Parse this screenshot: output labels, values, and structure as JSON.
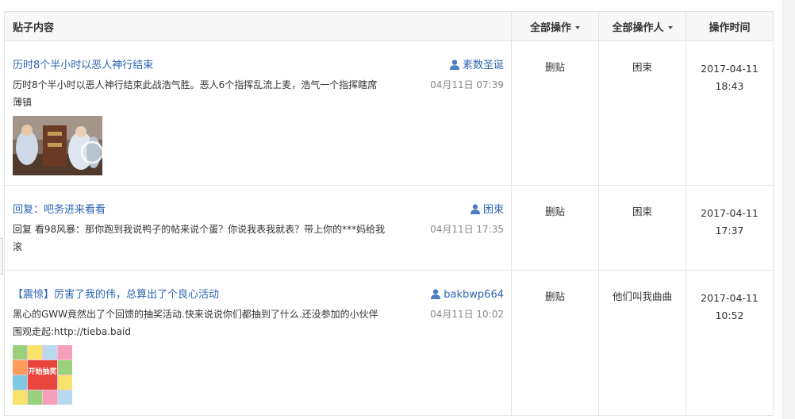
{
  "headers": {
    "content": "贴子内容",
    "operation": "全部操作",
    "operator": "全部操作人",
    "time": "操作时间"
  },
  "rows": [
    {
      "title": "历时8个半小时以恶人神行结束",
      "author": "素数圣诞",
      "post_time": "04月11日 07:39",
      "body": "历时8个半小时以恶人神行结束此战浩气胜。恶人6个指挥乱流上麦，浩气一个指挥瞎席薄镇",
      "operation": "删贴",
      "operator": "困束",
      "op_date": "2017-04-11",
      "op_clock": "18:43",
      "thumb": "game-scene-thumbnail"
    },
    {
      "title": "回复：吧务进来看看",
      "author": "困束",
      "post_time": "04月11日 17:35",
      "body": "回复 看98风暴：那你跑到我说鸭子的帖来说个蛋？你说我表我就表？带上你的***妈给我滚",
      "operation": "删贴",
      "operator": "困束",
      "op_date": "2017-04-11",
      "op_clock": "17:37"
    },
    {
      "title": "【震惊】厉害了我的伟，总算出了个良心活动",
      "author": "bakbwp664",
      "post_time": "04月11日 10:02",
      "body": "黑心的GWW竟然出了个回馈的抽奖活动.快来说说你们都抽到了什么.还没参加的小伙伴围观走起:http://tieba.baid",
      "operation": "删贴",
      "operator": "他们叫我曲曲",
      "op_date": "2017-04-11",
      "op_clock": "10:52",
      "thumb": "lottery-grid-thumbnail",
      "thumb_label": "开始抽奖"
    }
  ],
  "colors": {
    "link": "#2d64b3",
    "border": "#e3e3e3",
    "header_bg": "#f7f7f7"
  },
  "icons": {
    "user": "user-icon",
    "dropdown": "caret-down-icon"
  }
}
